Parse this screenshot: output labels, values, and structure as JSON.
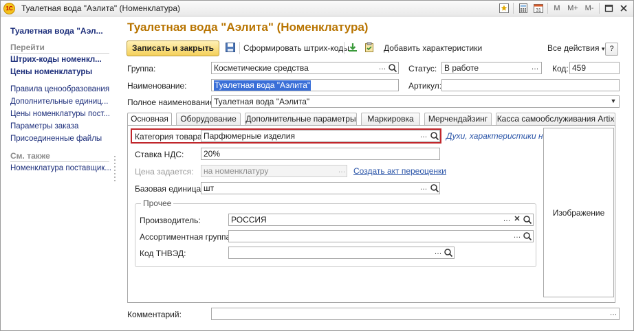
{
  "window": {
    "title": "Туалетная вода \"Аэлита\" (Номенклатура)",
    "buttons": [
      "M",
      "M+",
      "M-"
    ]
  },
  "sidebar": {
    "title": "Туалетная вода \"Аэл...",
    "go_section": "Перейти",
    "nav_items": [
      "Штрих-коды номенкл...",
      "Цены номенклатуры"
    ],
    "items": [
      "Правила ценообразования",
      "Дополнительные единиц...",
      "Цены номенклатуры пост...",
      "Параметры заказа",
      "Присоединенные файлы"
    ],
    "see_also_section": "См. также",
    "see_also_items": [
      "Номенклатура поставщик..."
    ]
  },
  "form": {
    "title": "Туалетная вода \"Аэлита\" (Номенклатура)",
    "toolbar": {
      "save_close": "Записать и закрыть",
      "barcodes": "Сформировать штрих-коды",
      "add_characteristics": "Добавить характеристики",
      "all_actions": "Все действия",
      "help": "?"
    },
    "group_label": "Группа:",
    "group_value": "Косметические средства",
    "status_label": "Статус:",
    "status_value": "В работе",
    "code_label": "Код:",
    "code_value": "459",
    "name_label": "Наименование:",
    "name_value": "Туалетная вода \"Аэлита\"",
    "article_label": "Артикул:",
    "article_value": "",
    "full_name_label": "Полное наименование:",
    "full_name_value": "Туалетная вода \"Аэлита\"",
    "tabs": [
      "Основная",
      "Оборудование",
      "Дополнительные параметры",
      "Маркировка",
      "Мерчендайзинг",
      "Касса самообслуживания Artix"
    ],
    "category_label": "Категория товара:",
    "category_value": "Парфюмерные изделия",
    "category_link": "Духи, характеристики н...",
    "vat_label": "Ставка НДС:",
    "vat_value": "20%",
    "price_label": "Цена задается:",
    "price_value": "на номенклатуру",
    "revaluation_link": "Создать акт переоценки",
    "unit_label": "Базовая единица:",
    "unit_value": "шт",
    "other_group": "Прочее",
    "manufacturer_label": "Производитель:",
    "manufacturer_value": "РОССИЯ",
    "assortment_label": "Ассортиментная группа:",
    "assortment_value": "",
    "tnved_label": "Код ТНВЭД:",
    "tnved_value": "",
    "image_label": "Изображение",
    "comment_label": "Комментарий:",
    "comment_value": ""
  }
}
